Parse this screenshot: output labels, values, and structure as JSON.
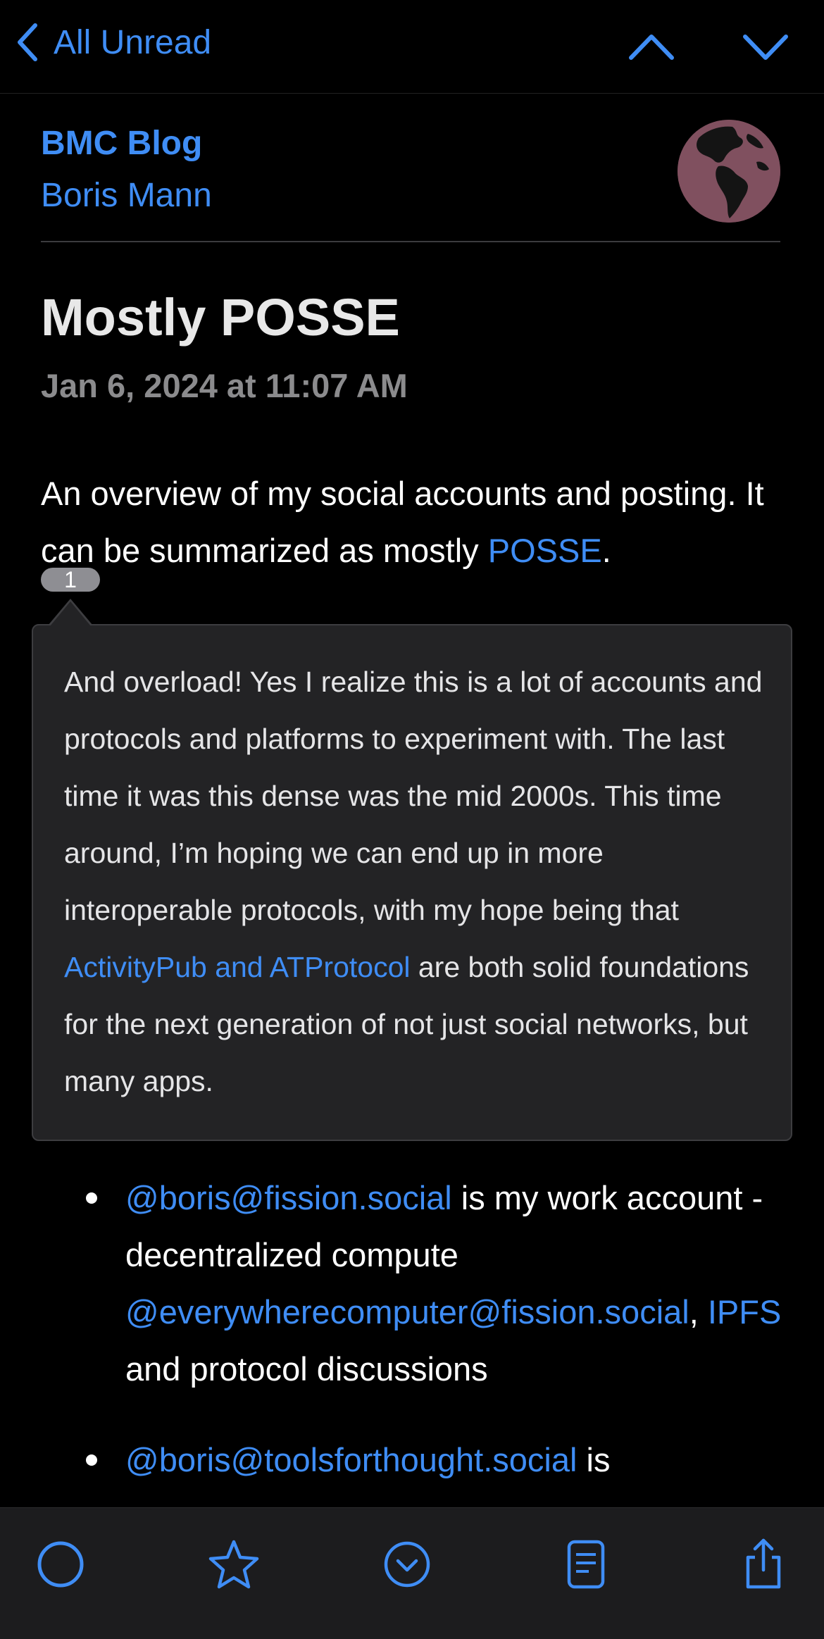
{
  "nav": {
    "back_label": "All Unread"
  },
  "header": {
    "feed_title": "BMC Blog",
    "author": "Boris Mann"
  },
  "article": {
    "title": "Mostly POSSE",
    "date": "Jan 6, 2024 at 11:07 AM",
    "intro_text": "An overview of my social accounts and posting. It can be summarized as mostly ",
    "intro_link": "POSSE",
    "intro_end": ".",
    "footnote_number": "1"
  },
  "footnote": {
    "text_before": "And overload! Yes I realize this is a lot of accounts and protocols and platforms to experiment with. The last time it was this dense was the mid 2000s. This time around, I’m hoping we can end up in more interoperable protocols, with my hope being that ",
    "link": "ActivityPub and ATProtocol",
    "text_after": " are both solid foundations for the next generation of not just social networks, but many apps."
  },
  "list": [
    {
      "link1": "@boris@fission.social",
      "text1": " is my work account - decentralized compute ",
      "link2": "@everywherecomputer@fission.social",
      "text2": ", ",
      "link3": "IPFS",
      "text3": " and protocol discussions"
    },
    {
      "link1": "@boris@toolsforthought.social",
      "text1": " is"
    }
  ],
  "colors": {
    "accent": "#3f8df5",
    "background": "#000000",
    "popover": "#232325",
    "toolbar": "#1c1c1e"
  },
  "toolbar": {
    "icons": [
      "circle-icon",
      "star-icon",
      "chevron-circle-icon",
      "reader-icon",
      "share-icon"
    ]
  }
}
